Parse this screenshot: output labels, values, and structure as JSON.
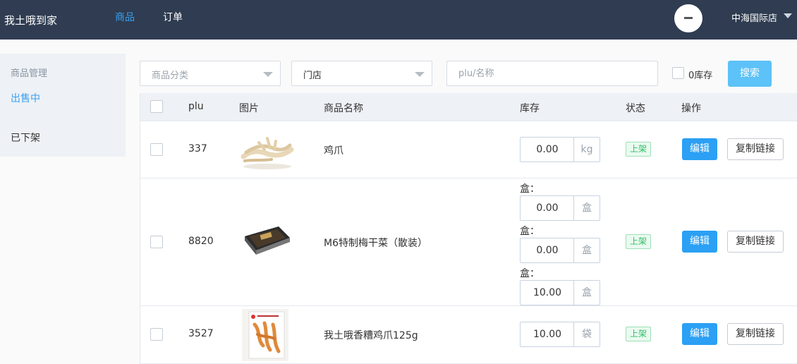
{
  "header": {
    "brand": "我土哦到家",
    "nav": [
      {
        "label": "商品",
        "active": true
      },
      {
        "label": "订单",
        "active": false
      }
    ],
    "store_name": "中海国际店",
    "accent_color": "#3aa0f0",
    "bg_color": "#2f3c51"
  },
  "sidebar": {
    "title": "商品管理",
    "items": [
      {
        "label": "出售中",
        "active": true
      },
      {
        "label": "已下架",
        "active": false
      }
    ]
  },
  "filters": {
    "category_placeholder": "商品分类",
    "store_value": "门店",
    "search_placeholder": "plu/名称",
    "zero_stock_label": "0库存",
    "search_button": "搜索"
  },
  "table": {
    "columns": [
      "plu",
      "图片",
      "商品名称",
      "库存",
      "状态",
      "操作"
    ],
    "rows": [
      {
        "plu": "337",
        "name": "鸡爪",
        "image_icon": "chicken-feet-photo",
        "stock": [
          {
            "label": "",
            "value": "0.00",
            "unit": "kg"
          }
        ],
        "status": "上架",
        "edit_label": "编辑",
        "copy_label": "复制链接"
      },
      {
        "plu": "8820",
        "name": "M6特制梅干菜（散装）",
        "image_icon": "preserved-vegetable-box-photo",
        "stock": [
          {
            "label": "盒：",
            "value": "0.00",
            "unit": "盒"
          },
          {
            "label": "盒：",
            "value": "0.00",
            "unit": "盒"
          },
          {
            "label": "盒：",
            "value": "10.00",
            "unit": "盒"
          }
        ],
        "status": "上架",
        "edit_label": "编辑",
        "copy_label": "复制链接"
      },
      {
        "plu": "3527",
        "name": "我土哦香糟鸡爪125g",
        "image_icon": "packaged-chicken-feet-photo",
        "stock": [
          {
            "label": "",
            "value": "10.00",
            "unit": "袋"
          }
        ],
        "status": "上架",
        "edit_label": "编辑",
        "copy_label": "复制链接"
      }
    ]
  }
}
